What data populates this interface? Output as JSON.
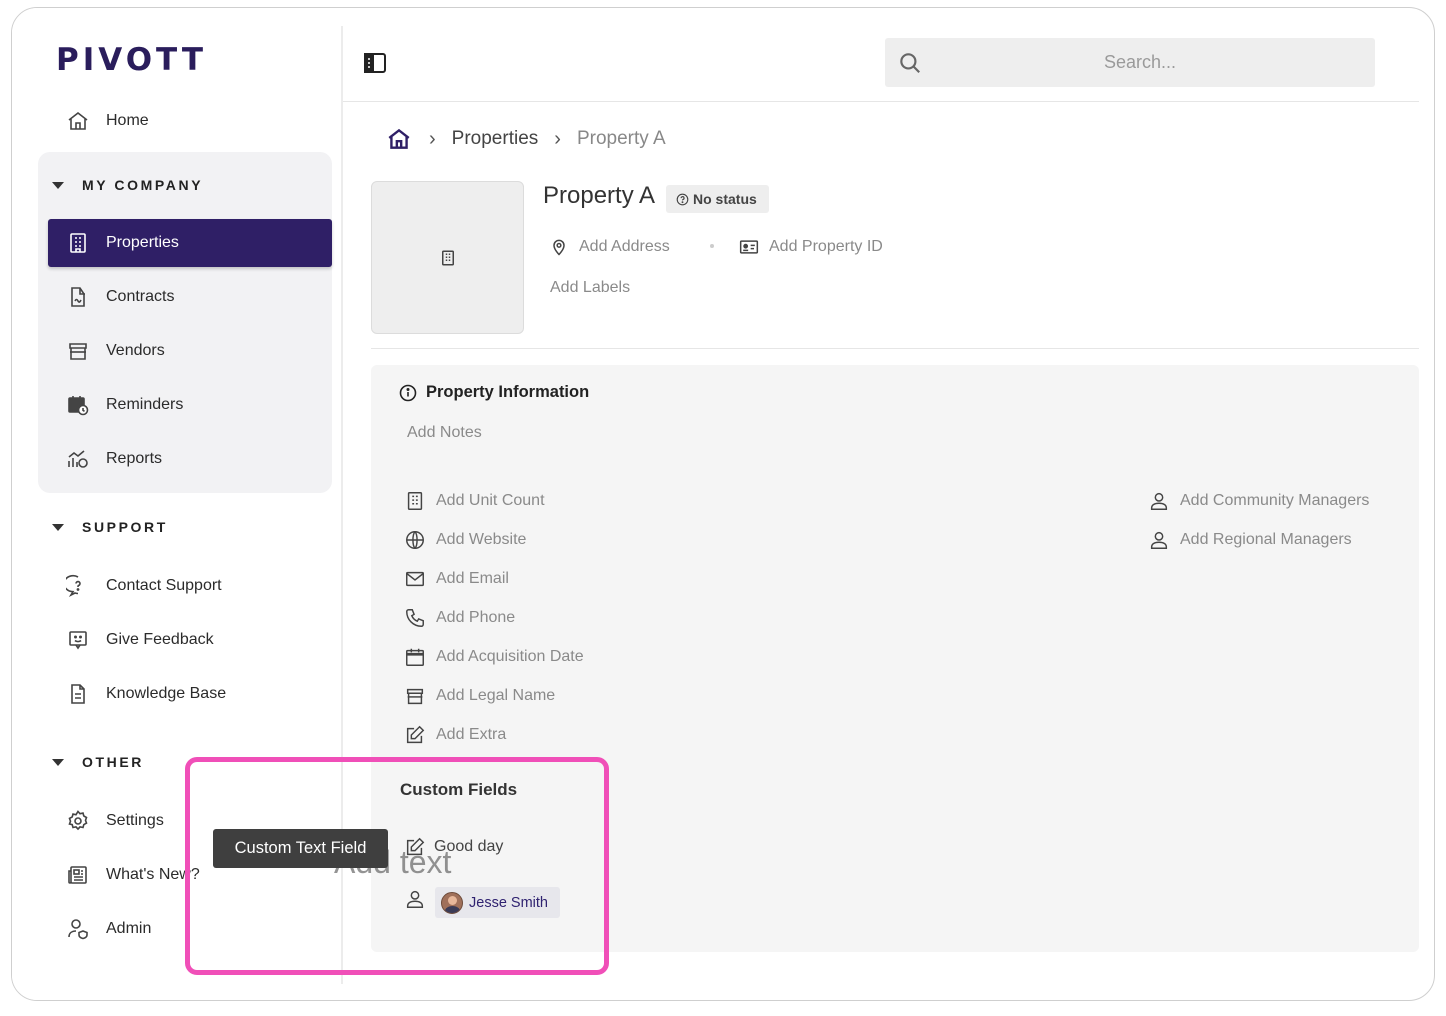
{
  "app": {
    "logo": "PIVOTT"
  },
  "sidebar": {
    "home": "Home",
    "sections": {
      "company": "MY COMPANY",
      "support": "SUPPORT",
      "other": "OTHER"
    },
    "company_items": [
      "Properties",
      "Contracts",
      "Vendors",
      "Reminders",
      "Reports"
    ],
    "support_items": [
      "Contact Support",
      "Give Feedback",
      "Knowledge Base"
    ],
    "other_items": [
      "Settings",
      "What's New?",
      "Admin"
    ]
  },
  "search": {
    "placeholder": "Search..."
  },
  "breadcrumb": {
    "level1": "Properties",
    "level2": "Property A"
  },
  "property": {
    "name": "Property A",
    "status": "No status",
    "add_address": "Add Address",
    "add_property_id": "Add Property ID",
    "add_labels": "Add Labels"
  },
  "info": {
    "title": "Property Information",
    "add_notes": "Add Notes",
    "left_fields": [
      "Add Unit Count",
      "Add Website",
      "Add Email",
      "Add Phone",
      "Add Acquisition Date",
      "Add Legal Name",
      "Add Extra"
    ],
    "right_fields": [
      "Add Community Managers",
      "Add Regional Managers"
    ]
  },
  "custom_fields": {
    "title": "Custom Fields",
    "text_value": "Good day",
    "user_value": "Jesse Smith"
  },
  "overlay": {
    "tooltip": "Custom Text Field",
    "drag_ghost": "Add text",
    "highlight_color": "#f04fb8"
  },
  "colors": {
    "brand": "#2f1f66"
  }
}
